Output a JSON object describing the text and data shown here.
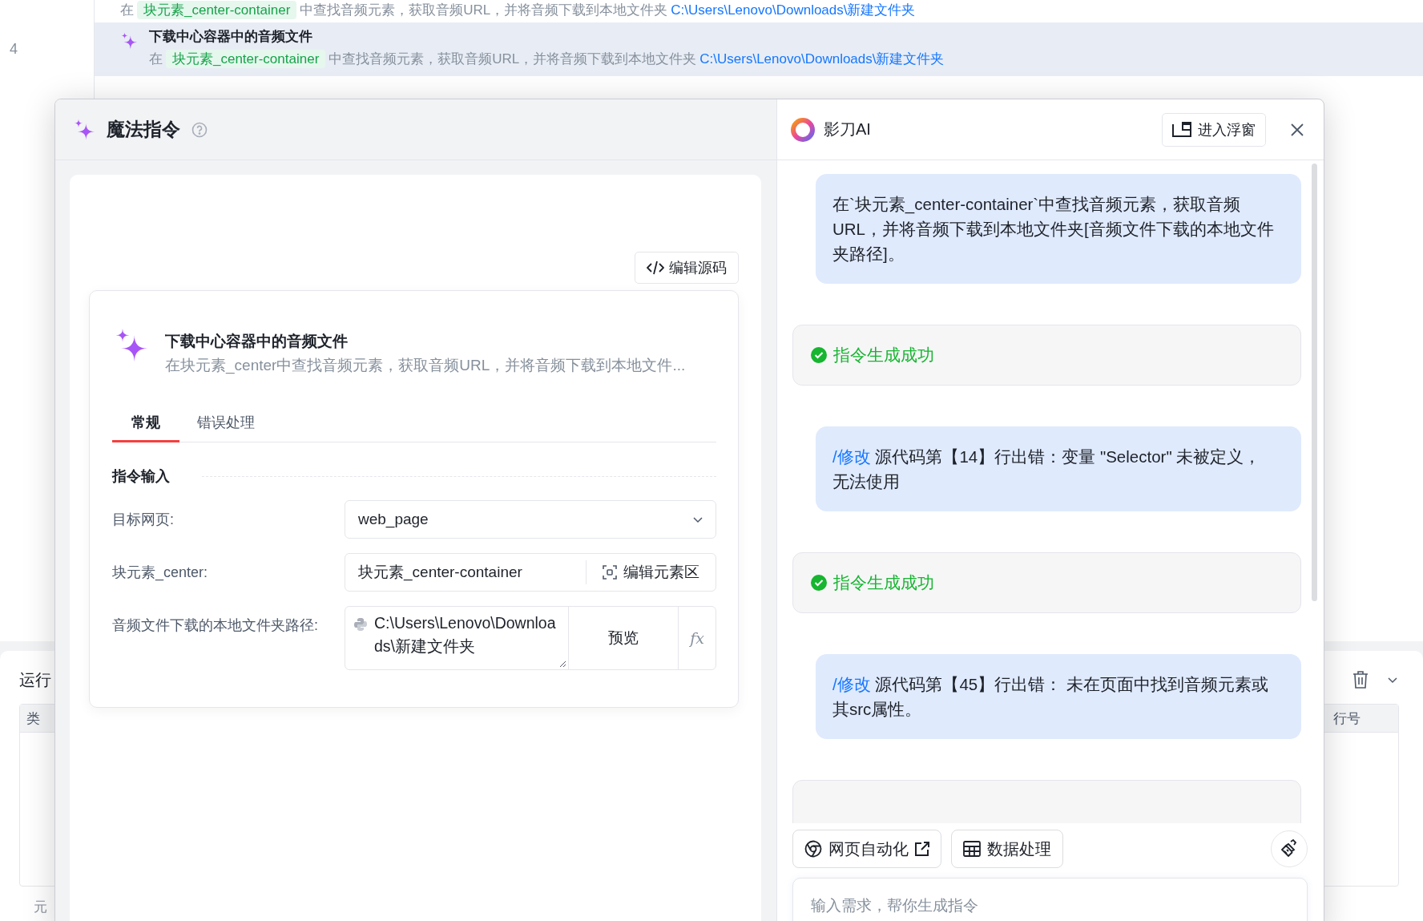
{
  "editor_rows": [
    {
      "desc_prefix": "在",
      "element_chip": "块元素_center-container",
      "desc_middle": "中查找音频元素，获取音频URL，并将音频下载到本地文件夹",
      "path_link": "C:\\Users\\Lenovo\\Downloads\\新建文件夹",
      "selected": false
    },
    {
      "line_number": "4",
      "title": "下载中心容器中的音频文件",
      "desc_prefix": "在",
      "element_chip": "块元素_center-container",
      "desc_middle": "中查找音频元素，获取音频URL，并将音频下载到本地文件夹",
      "path_link": "C:\\Users\\Lenovo\\Downloads\\新建文件夹",
      "selected": true
    }
  ],
  "run_panel": {
    "title": "运行",
    "columns": [
      "类",
      "行号"
    ],
    "footer_label": "元"
  },
  "magic_panel": {
    "title": "魔法指令",
    "edit_source_button": "编辑源码",
    "instruction": {
      "title": "下载中心容器中的音频文件",
      "description": "在块元素_center中查找音频元素，获取音频URL，并将音频下载到本地文件..."
    },
    "tabs": [
      {
        "label": "常规",
        "selected": true
      },
      {
        "label": "错误处理",
        "selected": false
      }
    ],
    "section_title": "指令输入",
    "fields": [
      {
        "kind": "select",
        "label": "目标网页:",
        "value": "web_page"
      },
      {
        "kind": "element",
        "label": "块元素_center:",
        "value": "块元素_center-container",
        "action": "编辑元素区"
      },
      {
        "kind": "path",
        "label": "音频文件下载的本地文件夹路径:",
        "value": "C:\\Users\\Lenovo\\Downloads\\新建文件夹",
        "action": "预览",
        "formula": "fx"
      }
    ]
  },
  "assistant": {
    "name": "影刀AI",
    "float_button": "进入浮窗",
    "messages": [
      {
        "kind": "user",
        "text": "在`块元素_center-container`中查找音频元素，获取音频URL，并将音频下载到本地文件夹[音频文件下载的本地文件夹路径]。"
      },
      {
        "kind": "status",
        "text": "指令生成成功"
      },
      {
        "kind": "user",
        "command": "/修改",
        "text": "源代码第【14】行出错：变量 \"Selector\" 未被定义，无法使用"
      },
      {
        "kind": "status",
        "text": "指令生成成功"
      },
      {
        "kind": "user",
        "command": "/修改",
        "text": "源代码第【45】行出错： 未在页面中找到音频元素或其src属性。"
      },
      {
        "kind": "card"
      }
    ],
    "quick_actions": [
      {
        "kind": "web",
        "label": "网页自动化",
        "external": true
      },
      {
        "kind": "data",
        "label": "数据处理",
        "external": false
      }
    ],
    "input": {
      "placeholder": "输入需求，帮你生成指令"
    }
  }
}
